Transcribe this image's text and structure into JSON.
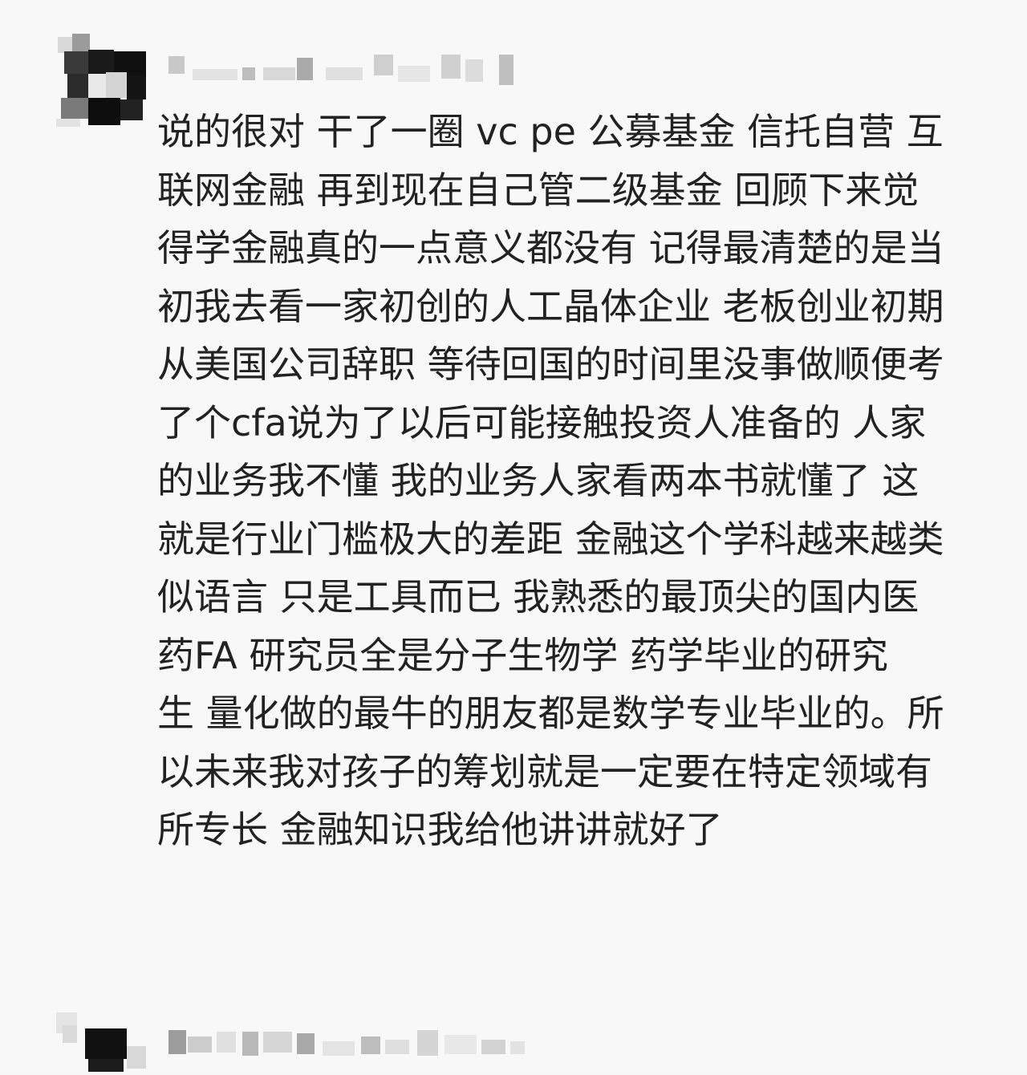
{
  "comment": {
    "author_name": "",
    "lines": [
      "说的很对 干了一圈 vc pe 公募基金 信托自营 互",
      "联网金融 再到现在自己管二级基金 回顾下来觉",
      "得学金融真的一点意义都没有 记得最清楚的是当",
      "初我去看一家初创的人工晶体企业 老板创业初期",
      "从美国公司辞职 等待回国的时间里没事做顺便考",
      "了个cfa说为了以后可能接触投资人准备的 人家",
      "的业务我不懂 我的业务人家看两本书就懂了 这",
      "就是行业门槛极大的差距 金融这个学科越来越类",
      "似语言 只是工具而已 我熟悉的最顶尖的国内医",
      "药FA 研究员全是分子生物学 药学毕业的研究",
      "生 量化做的最牛的朋友都是数学专业毕业的。所",
      "以未来我对孩子的筹划就是一定要在特定领域有",
      "所专长 金融知识我给他讲讲就好了"
    ]
  },
  "reply": {
    "author_name": ""
  },
  "icons": {
    "avatar": "blurred-avatar-icon",
    "reply_avatar": "blurred-avatar-icon"
  },
  "colors": {
    "background": "#f8f8f9",
    "text": "#222222",
    "blur_dark": "#111111",
    "blur_mid": "#8a8a8a",
    "blur_light": "#c9c9c9"
  }
}
